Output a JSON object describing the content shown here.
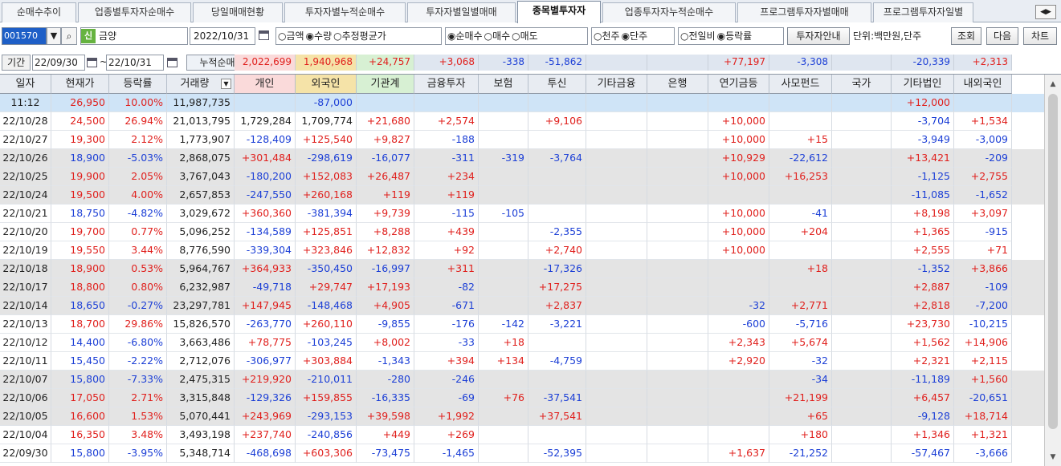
{
  "tabs": [
    {
      "label": "순매수추이",
      "active": false
    },
    {
      "label": "업종별투자자순매수",
      "active": false
    },
    {
      "label": "당일매매현황",
      "active": false
    },
    {
      "label": "투자자별누적순매수",
      "active": false
    },
    {
      "label": "투자자별일별매매",
      "active": false
    },
    {
      "label": "종목별투자자",
      "active": true
    },
    {
      "label": "업종투자자누적순매수",
      "active": false
    },
    {
      "label": "프로그램투자자별매매",
      "active": false
    },
    {
      "label": "프로그램투자자일별",
      "active": false
    }
  ],
  "toolbar": {
    "stock_code": "001570",
    "market_badge": "신",
    "stock_name": "금양",
    "date": "2022/10/31",
    "amount_group": [
      "○금액",
      "◉수량",
      "○추정평균가"
    ],
    "trade_group": [
      "◉순매수",
      "○매수",
      "○매도"
    ],
    "unit_group": [
      "○천주",
      "◉단주"
    ],
    "compare_group": [
      "○전일비",
      "◉등락률"
    ],
    "investor_info_button": "투자자안내",
    "unit_label": "단위:백만원,단주",
    "search_button": "조회",
    "next_button": "다음",
    "chart_button": "차트"
  },
  "summary": {
    "period_label": "기간",
    "start_date": "22/09/30",
    "end_date": "22/10/31",
    "separator": "~",
    "title": "누적순매수",
    "values": [
      "2,022,699",
      "1,940,968",
      "+24,757",
      "+3,068",
      "-338",
      "-51,862",
      "",
      "",
      "+77,197",
      "-3,308",
      "",
      "-20,339",
      "+2,313"
    ]
  },
  "columns": [
    "일자",
    "현재가",
    "등락률",
    "거래량",
    "개인",
    "외국인",
    "기관계",
    "금융투자",
    "보험",
    "투신",
    "기타금융",
    "은행",
    "연기금등",
    "사모펀드",
    "국가",
    "기타법인",
    "내외국인"
  ],
  "rows": [
    [
      "11:12",
      "26,950",
      "10.00%",
      "11,987,735",
      "",
      "-87,000",
      "",
      "",
      "",
      "",
      "",
      "",
      "",
      "",
      "",
      "+12,000",
      ""
    ],
    [
      "22/10/28",
      "24,500",
      "26.94%",
      "21,013,795",
      "1,729,284",
      "1,709,774",
      "+21,680",
      "+2,574",
      "",
      "+9,106",
      "",
      "",
      "+10,000",
      "",
      "",
      "-3,704",
      "+1,534"
    ],
    [
      "22/10/27",
      "19,300",
      "2.12%",
      "1,773,907",
      "-128,409",
      "+125,540",
      "+9,827",
      "-188",
      "",
      "",
      "",
      "",
      "+10,000",
      "+15",
      "",
      "-3,949",
      "-3,009"
    ],
    [
      "22/10/26",
      "18,900",
      "-5.03%",
      "2,868,075",
      "+301,484",
      "-298,619",
      "-16,077",
      "-311",
      "-319",
      "-3,764",
      "",
      "",
      "+10,929",
      "-22,612",
      "",
      "+13,421",
      "-209"
    ],
    [
      "22/10/25",
      "19,900",
      "2.05%",
      "3,767,043",
      "-180,200",
      "+152,083",
      "+26,487",
      "+234",
      "",
      "",
      "",
      "",
      "+10,000",
      "+16,253",
      "",
      "-1,125",
      "+2,755"
    ],
    [
      "22/10/24",
      "19,500",
      "4.00%",
      "2,657,853",
      "-247,550",
      "+260,168",
      "+119",
      "+119",
      "",
      "",
      "",
      "",
      "",
      "",
      "",
      "-11,085",
      "-1,652"
    ],
    [
      "22/10/21",
      "18,750",
      "-4.82%",
      "3,029,672",
      "+360,360",
      "-381,394",
      "+9,739",
      "-115",
      "-105",
      "",
      "",
      "",
      "+10,000",
      "-41",
      "",
      "+8,198",
      "+3,097"
    ],
    [
      "22/10/20",
      "19,700",
      "0.77%",
      "5,096,252",
      "-134,589",
      "+125,851",
      "+8,288",
      "+439",
      "",
      "-2,355",
      "",
      "",
      "+10,000",
      "+204",
      "",
      "+1,365",
      "-915"
    ],
    [
      "22/10/19",
      "19,550",
      "3.44%",
      "8,776,590",
      "-339,304",
      "+323,846",
      "+12,832",
      "+92",
      "",
      "+2,740",
      "",
      "",
      "+10,000",
      "",
      "",
      "+2,555",
      "+71"
    ],
    [
      "22/10/18",
      "18,900",
      "0.53%",
      "5,964,767",
      "+364,933",
      "-350,450",
      "-16,997",
      "+311",
      "",
      "-17,326",
      "",
      "",
      "",
      "+18",
      "",
      "-1,352",
      "+3,866"
    ],
    [
      "22/10/17",
      "18,800",
      "0.80%",
      "6,232,987",
      "-49,718",
      "+29,747",
      "+17,193",
      "-82",
      "",
      "+17,275",
      "",
      "",
      "",
      "",
      "",
      "+2,887",
      "-109"
    ],
    [
      "22/10/14",
      "18,650",
      "-0.27%",
      "23,297,781",
      "+147,945",
      "-148,468",
      "+4,905",
      "-671",
      "",
      "+2,837",
      "",
      "",
      "-32",
      "+2,771",
      "",
      "+2,818",
      "-7,200"
    ],
    [
      "22/10/13",
      "18,700",
      "29.86%",
      "15,826,570",
      "-263,770",
      "+260,110",
      "-9,855",
      "-176",
      "-142",
      "-3,221",
      "",
      "",
      "-600",
      "-5,716",
      "",
      "+23,730",
      "-10,215"
    ],
    [
      "22/10/12",
      "14,400",
      "-6.80%",
      "3,663,486",
      "+78,775",
      "-103,245",
      "+8,002",
      "-33",
      "+18",
      "",
      "",
      "",
      "+2,343",
      "+5,674",
      "",
      "+1,562",
      "+14,906"
    ],
    [
      "22/10/11",
      "15,450",
      "-2.22%",
      "2,712,076",
      "-306,977",
      "+303,884",
      "-1,343",
      "+394",
      "+134",
      "-4,759",
      "",
      "",
      "+2,920",
      "-32",
      "",
      "+2,321",
      "+2,115"
    ],
    [
      "22/10/07",
      "15,800",
      "-7.33%",
      "2,475,315",
      "+219,920",
      "-210,011",
      "-280",
      "-246",
      "",
      "",
      "",
      "",
      "",
      "-34",
      "",
      "-11,189",
      "+1,560"
    ],
    [
      "22/10/06",
      "17,050",
      "2.71%",
      "3,315,848",
      "-129,326",
      "+159,855",
      "-16,335",
      "-69",
      "+76",
      "-37,541",
      "",
      "",
      "",
      "+21,199",
      "",
      "+6,457",
      "-20,651"
    ],
    [
      "22/10/05",
      "16,600",
      "1.53%",
      "5,070,441",
      "+243,969",
      "-293,153",
      "+39,598",
      "+1,992",
      "",
      "+37,541",
      "",
      "",
      "",
      "+65",
      "",
      "-9,128",
      "+18,714"
    ],
    [
      "22/10/04",
      "16,350",
      "3.48%",
      "3,493,198",
      "+237,740",
      "-240,856",
      "+449",
      "+269",
      "",
      "",
      "",
      "",
      "",
      "+180",
      "",
      "+1,346",
      "+1,321"
    ],
    [
      "22/09/30",
      "15,800",
      "-3.95%",
      "5,348,714",
      "-468,698",
      "+603,306",
      "-73,475",
      "-1,465",
      "",
      "-52,395",
      "",
      "",
      "+1,637",
      "-21,252",
      "",
      "-57,467",
      "-3,666"
    ]
  ],
  "colors": {
    "positive": "#e0201d",
    "negative": "#1c3fd6",
    "row_highlight": "#cfe4f7",
    "row_shade": "#e4e4e4"
  }
}
